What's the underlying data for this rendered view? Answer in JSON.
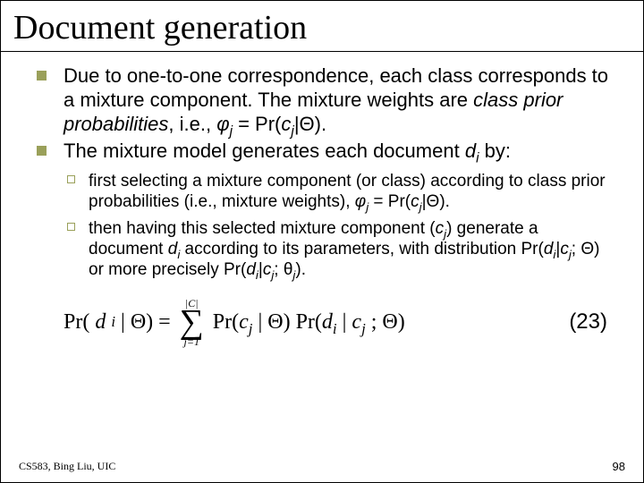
{
  "title": "Document generation",
  "bullets": {
    "b1_pre": "Due to one-to-one correspondence, each class corresponds to a mixture component. The mixture weights are ",
    "b1_ital": "class prior probabilities",
    "b1_post": ", i.e., ",
    "b1_formula_pre": "φ",
    "b1_formula_sub": "j",
    "b1_formula_mid": " = Pr(",
    "b1_formula_c": "c",
    "b1_formula_cj": "j",
    "b1_formula_end": "|Θ).",
    "b2_pre": "The mixture model generates each document ",
    "b2_d": "d",
    "b2_di": "i",
    "b2_post": " by:"
  },
  "sub": {
    "s1": "first selecting a mixture component (or class) according to class prior probabilities (i.e., mixture weights), ",
    "s1_phi": "φ",
    "s1_j": "j",
    "s1_mid": " = Pr(",
    "s1_c": "c",
    "s1_cj": "j",
    "s1_end": "|Θ).",
    "s2_a": "then having this selected mixture component (",
    "s2_c": "c",
    "s2_cj": "j",
    "s2_b": ") generate a document ",
    "s2_d": "d",
    "s2_di": "i",
    "s2_cpart": " according to its parameters, with distribution Pr(",
    "s2_d2": "d",
    "s2_di2": "i",
    "s2_bar": "|",
    "s2_c2": "c",
    "s2_cj2": "j",
    "s2_semi": "; Θ) or more precisely Pr(",
    "s2_d3": "d",
    "s2_di3": "i",
    "s2_bar2": "|",
    "s2_c3": "c",
    "s2_cj3": "j",
    "s2_semi2": "; θ",
    "s2_thj": "j",
    "s2_close": ")."
  },
  "equation": {
    "lhs_pr": "Pr(",
    "lhs_d": "d",
    "lhs_i": "i",
    "lhs_mid": " | Θ) = ",
    "sum_top": "|C|",
    "sum_bot": "j=1",
    "rhs_pr1": "Pr(",
    "rhs_c1": "c",
    "rhs_j1": "j",
    "rhs_mid1": " | Θ) Pr(",
    "rhs_d": "d",
    "rhs_di": "i",
    "rhs_bar": " | ",
    "rhs_c2": "c",
    "rhs_j2": "j",
    "rhs_end": " ; Θ)"
  },
  "eq_label": "(23)",
  "footer_left": "CS583, Bing Liu, UIC",
  "footer_right": "98"
}
